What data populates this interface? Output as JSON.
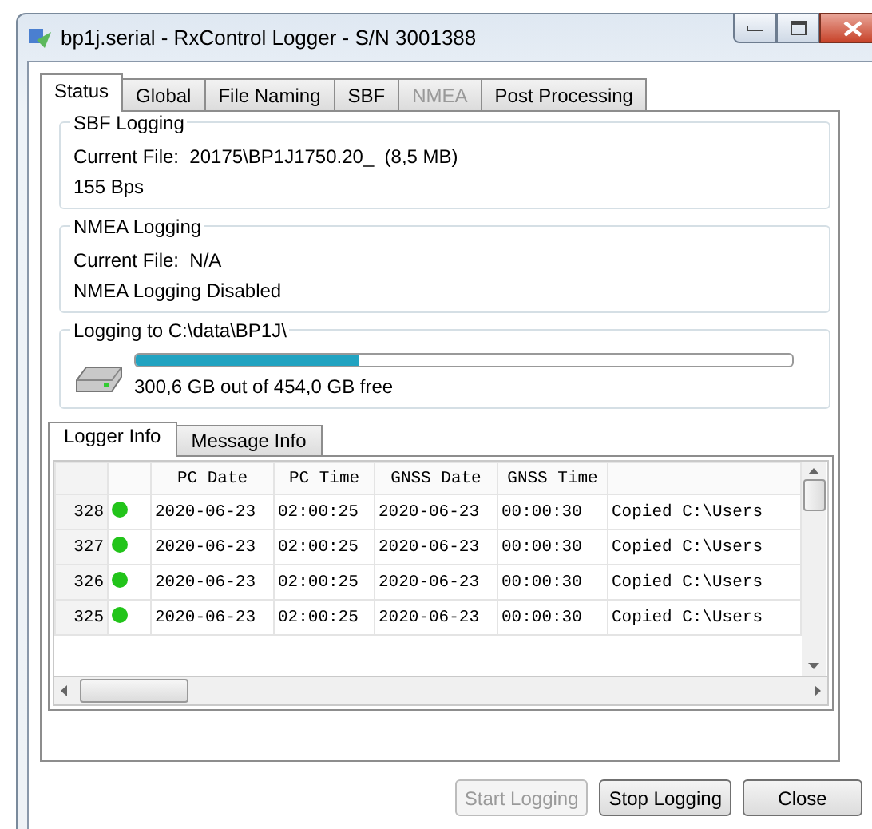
{
  "window": {
    "title": "bp1j.serial - RxControl Logger - S/N 3001388"
  },
  "tabs": [
    {
      "label": "Status",
      "selected": true,
      "disabled": false
    },
    {
      "label": "Global",
      "selected": false,
      "disabled": false
    },
    {
      "label": "File Naming",
      "selected": false,
      "disabled": false
    },
    {
      "label": "SBF",
      "selected": false,
      "disabled": false
    },
    {
      "label": "NMEA",
      "selected": false,
      "disabled": true
    },
    {
      "label": "Post Processing",
      "selected": false,
      "disabled": false
    }
  ],
  "sbf_logging": {
    "title": "SBF Logging",
    "lines": [
      "Current File:  20175\\BP1J1750.20_  (8,5 MB)",
      "155 Bps"
    ]
  },
  "nmea_logging": {
    "title": "NMEA Logging",
    "lines": [
      "Current File:  N/A",
      "NMEA Logging Disabled"
    ]
  },
  "disk": {
    "title": "Logging to C:\\data\\BP1J\\",
    "level": 0.34,
    "free_text": "300,6 GB out of 454,0 GB free"
  },
  "info_tabs": [
    {
      "label": "Logger Info",
      "selected": true
    },
    {
      "label": "Message Info",
      "selected": false
    }
  ],
  "table": {
    "columns": [
      "PC Date",
      "PC Time",
      "GNSS Date",
      "GNSS Time"
    ],
    "rows": [
      {
        "number": "328",
        "color": "#22c41a",
        "cells": [
          "2020-06-23",
          "02:00:25",
          "2020-06-23",
          "00:00:30",
          "Copied C:\\Users"
        ]
      },
      {
        "number": "327",
        "color": "#22c41a",
        "cells": [
          "2020-06-23",
          "02:00:25",
          "2020-06-23",
          "00:00:30",
          "Copied C:\\Users"
        ]
      },
      {
        "number": "326",
        "color": "#22c41a",
        "cells": [
          "2020-06-23",
          "02:00:25",
          "2020-06-23",
          "00:00:30",
          "Copied C:\\Users"
        ]
      },
      {
        "number": "325",
        "color": "#22c41a",
        "cells": [
          "2020-06-23",
          "02:00:25",
          "2020-06-23",
          "00:00:30",
          "Copied C:\\Users"
        ]
      }
    ]
  },
  "buttons": [
    {
      "label": "Start Logging",
      "disabled": true
    },
    {
      "label": "Stop Logging",
      "disabled": false
    },
    {
      "label": "Close",
      "disabled": false
    }
  ]
}
